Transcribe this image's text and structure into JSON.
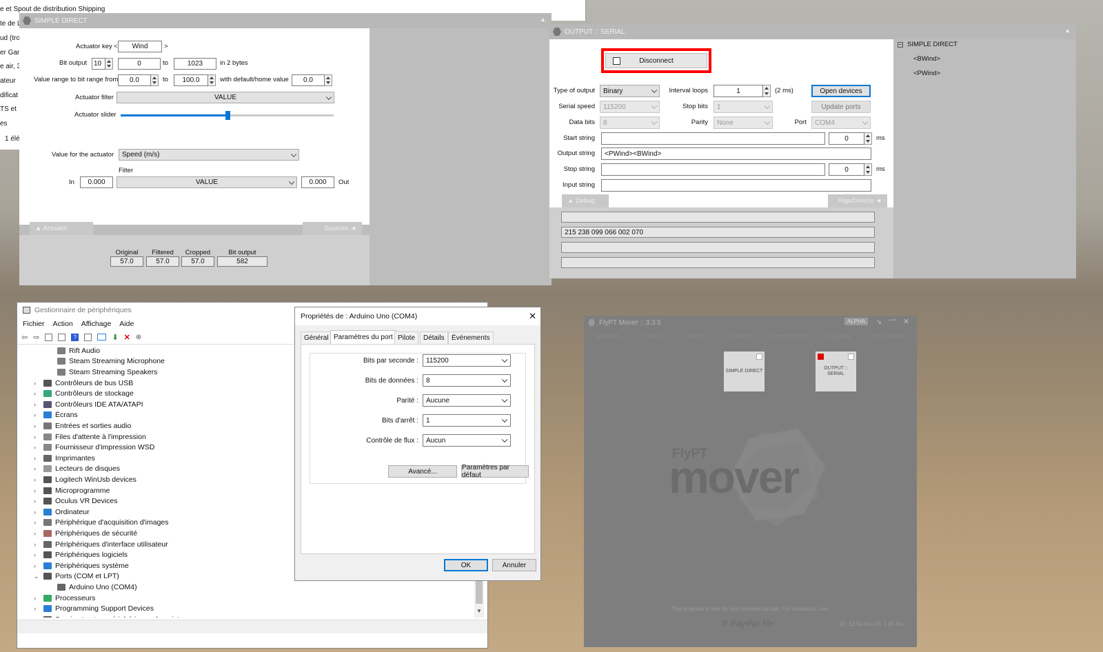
{
  "explorer_bg": {
    "lines": [
      "e et Spout de distribution Shipping",
      "te de L",
      "ud (tro",
      "er Gar",
      "e air, 3",
      "ateur",
      "dificat",
      "TS et",
      "es",
      "1 élé"
    ]
  },
  "simple_direct": {
    "title": "SIMPLE DIRECT",
    "actuator_key_label": "Actuator key",
    "key_prev": "<",
    "actuator_key": "Wind",
    "key_next": ">",
    "bit_output_label": "Bit output",
    "bit_output": "10",
    "bit_from": "0",
    "to1": "to",
    "bit_to": "1023",
    "bytes_label": "in 2 bytes",
    "range_label": "Value range to bit range from",
    "range_from": "0.0",
    "to2": "to",
    "range_to": "100.0",
    "home_label": "with default/home value",
    "home_value": "0.0",
    "filter_label": "Actuator filter",
    "filter_value": "VALUE",
    "slider_label": "Actuator slider",
    "slider_position": 0.5,
    "value_for_label": "Value for the actuator",
    "value_for": "Speed (m/s)",
    "filter2_label": "Filter",
    "in_label": "In",
    "in_value": "0.000",
    "filter2_value": "VALUE",
    "out_value": "0.000",
    "out_label": "Out",
    "tab_actuator": "▲  Actuator",
    "tab_sources": "Sources  ◄",
    "readouts": [
      {
        "label": "Original",
        "value": "57.0"
      },
      {
        "label": "Filtered",
        "value": "57.0"
      },
      {
        "label": "Cropped",
        "value": "57.0"
      },
      {
        "label": "Bit output",
        "value": "582"
      }
    ]
  },
  "output_serial": {
    "title": "OUTPUT :: SERIAL",
    "disconnect": "Disconnect",
    "type_label": "Type of output",
    "type_value": "Binary",
    "interval_label": "Interval loops",
    "interval_value": "1",
    "interval_ms": "(2 ms)",
    "open_devices": "Open devices",
    "speed_label": "Serial speed",
    "speed_value": "115200",
    "stop_bits_label": "Stop bits",
    "stop_bits_value": "1",
    "update_ports": "Update ports",
    "data_bits_label": "Data bits",
    "data_bits_value": "8",
    "parity_label": "Parity",
    "parity_value": "None",
    "port_label": "Port",
    "port_value": "COM4",
    "start_label": "Start string",
    "start_value": "",
    "start_ms": "0",
    "ms1": "ms",
    "output_label": "Output string",
    "output_value": "<PWind><BWind>",
    "stop_label": "Stop string",
    "stop_value": "",
    "stop_ms": "0",
    "ms2": "ms",
    "input_label": "Input string",
    "input_value": "",
    "tab_debug": "▲  Debug",
    "tab_rigs": "Rigs/Directs  ◄",
    "debug_lines": [
      "",
      "215 238 099 066 002 070",
      "",
      ""
    ],
    "tree_root": "SIMPLE DIRECT",
    "tree_items": [
      "<BWind>",
      "<PWind>"
    ]
  },
  "device_manager": {
    "title": "Gestionnaire de périphériques",
    "menu": [
      "Fichier",
      "Action",
      "Affichage",
      "Aide"
    ],
    "rows": [
      {
        "t": "Rift Audio",
        "child": true,
        "c": "#7d7d7d"
      },
      {
        "t": "Steam Streaming Microphone",
        "child": true,
        "c": "#7d7d7d"
      },
      {
        "t": "Steam Streaming Speakers",
        "child": true,
        "c": "#7d7d7d"
      },
      {
        "t": "Contrôleurs de bus USB",
        "c": "#555"
      },
      {
        "t": "Contrôleurs de stockage",
        "c": "#3a7"
      },
      {
        "t": "Contrôleurs IDE ATA/ATAPI",
        "c": "#557"
      },
      {
        "t": "Écrans",
        "c": "#2a7fd4"
      },
      {
        "t": "Entrées et sorties audio",
        "c": "#777"
      },
      {
        "t": "Files d'attente à l'impression",
        "c": "#888"
      },
      {
        "t": "Fournisseur d'impression WSD",
        "c": "#888"
      },
      {
        "t": "Imprimantes",
        "c": "#666"
      },
      {
        "t": "Lecteurs de disques",
        "c": "#999"
      },
      {
        "t": "Logitech WinUsb devices",
        "c": "#555"
      },
      {
        "t": "Microprogramme",
        "c": "#555"
      },
      {
        "t": "Oculus VR Devices",
        "c": "#555"
      },
      {
        "t": "Ordinateur",
        "c": "#2a7fd4"
      },
      {
        "t": "Périphérique d'acquisition d'images",
        "c": "#777"
      },
      {
        "t": "Périphériques de sécurité",
        "c": "#a66"
      },
      {
        "t": "Périphériques d'interface utilisateur",
        "c": "#666"
      },
      {
        "t": "Périphériques logiciels",
        "c": "#555"
      },
      {
        "t": "Périphériques système",
        "c": "#2a7fd4"
      },
      {
        "t": "Ports (COM et LPT)",
        "open": true,
        "c": "#555"
      },
      {
        "t": "Arduino Uno (COM4)",
        "child": true,
        "c": "#666"
      },
      {
        "t": "Processeurs",
        "c": "#3a6"
      },
      {
        "t": "Programming Support Devices",
        "c": "#2a7fd4"
      },
      {
        "t": "Souris et autres périphériques de pointage",
        "c": "#666"
      }
    ]
  },
  "properties": {
    "title": "Propriétés de : Arduino Uno (COM4)",
    "tabs": [
      "Général",
      "Paramètres du port",
      "Pilote",
      "Détails",
      "Événements"
    ],
    "fields": [
      {
        "label": "Bits par seconde :",
        "value": "115200"
      },
      {
        "label": "Bits de données :",
        "value": "8"
      },
      {
        "label": "Parité :",
        "value": "Aucune"
      },
      {
        "label": "Bits d'arrêt :",
        "value": "1"
      },
      {
        "label": "Contrôle de flux :",
        "value": "Aucun"
      }
    ],
    "advanced": "Avancé...",
    "defaults": "Paramètres par défaut",
    "ok": "OK",
    "cancel": "Annuler"
  },
  "flypt": {
    "title": "FlyPT Mover :: 3.3.5",
    "badge": "ALPHA",
    "tabs": [
      "Sources",
      "Poses",
      "Rigs",
      "Directs",
      "Transducers",
      "Outputs",
      "Visualizers"
    ],
    "tile1": "SIMPLE DIRECT",
    "tile2": "OUTPUT :: SERIAL",
    "logo_small": "FlyPT",
    "logo_big": "mover",
    "footer": "This program is free for non commercial use. For donations, use:",
    "paypal": "PayPal",
    "paypal_me": "Me",
    "stats": "UI: 12.94 ms   CA: 2.05 ms",
    "accent": "#e00000"
  }
}
